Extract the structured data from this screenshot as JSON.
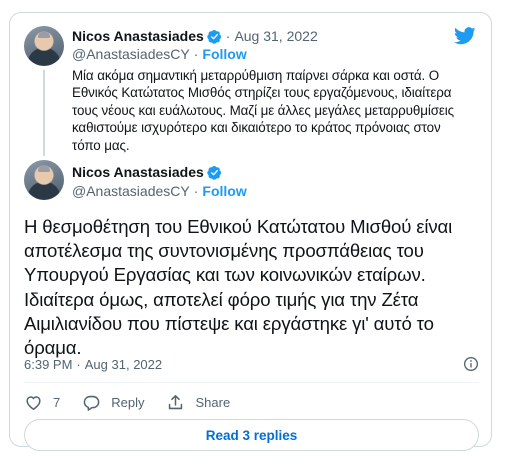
{
  "quoted_tweet": {
    "name": "Nicos Anastasiades",
    "handle": "@AnastasiadesCY",
    "separator": "·",
    "date": "Aug 31, 2022",
    "follow_label": "Follow",
    "text": "Μία ακόμα σημαντική μεταρρύθμιση παίρνει σάρκα και οστά. Ο Εθνικός Κατώτατος Μισθός στηρίζει τους εργαζόμενους, ιδιαίτερα τους νέους και ευάλωτους. Μαζί με άλλες μεγάλες μεταρρυθμίσεις καθιστούμε ισχυρότερο και δικαιότερο το κράτος πρόνοιας στον τόπο μας."
  },
  "main_tweet": {
    "name": "Nicos Anastasiades",
    "handle": "@AnastasiadesCY",
    "separator": "·",
    "follow_label": "Follow",
    "text": "Η θεσμοθέτηση του Εθνικού Κατώτατου Μισθού είναι αποτέλεσμα της συντονισμένης προσπάθειας του Υπουργού Εργασίας και των κοινωνικών εταίρων. Ιδιαίτερα όμως, αποτελεί φόρο τιμής για την Ζέτα Αιμιλιανίδου που πίστεψε και εργάστηκε γι' αυτό το όραμα.",
    "time": "6:39 PM",
    "date": "Aug 31, 2022"
  },
  "actions": {
    "like_count": "7",
    "reply_label": "Reply",
    "share_label": "Share"
  },
  "read_replies_label": "Read 3 replies",
  "colors": {
    "accent": "#1d9bf0",
    "verified": "#1d9bf0",
    "secondary_text": "#536471",
    "border": "#cfd9de"
  },
  "icons": [
    "twitter-bird-icon",
    "verified-badge-icon",
    "info-icon",
    "heart-icon",
    "reply-icon",
    "share-icon"
  ]
}
